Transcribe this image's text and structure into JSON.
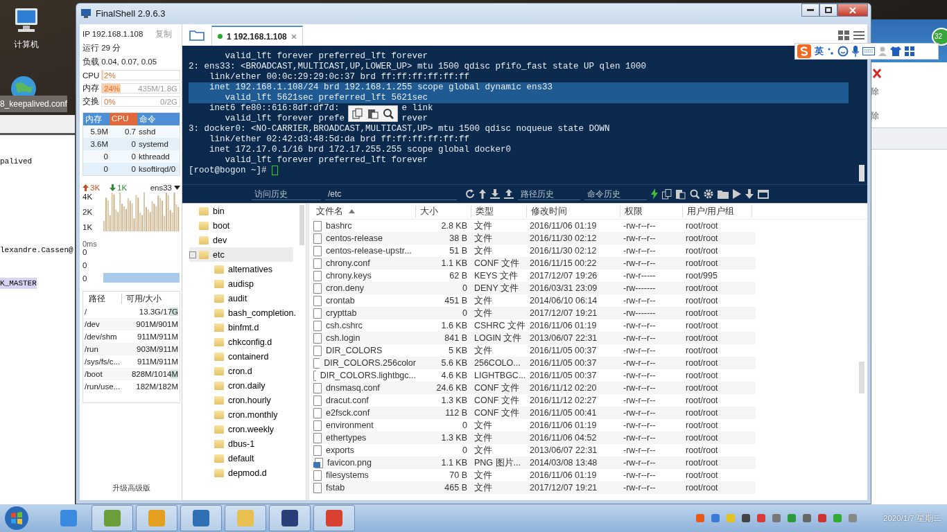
{
  "desktop": {
    "icons": [
      {
        "label": "计算机"
      }
    ]
  },
  "background_editor": {
    "tab": "8_keepalived.conf",
    "lines": [
      {
        "text": "palived",
        "highlighted": false
      },
      {
        "text": "lexandre.Cassen@",
        "highlighted": false
      },
      {
        "text": "K_MASTER",
        "highlighted": true
      }
    ]
  },
  "background_window": {
    "labels": [
      "除",
      "除"
    ],
    "badge": "32"
  },
  "input_method_bar": {
    "mode": "英"
  },
  "window": {
    "title": "FinalShell 2.9.6.3"
  },
  "sidebar": {
    "ip": "IP 192.168.1.108",
    "copy": "复制",
    "uptime": "运行 29 分",
    "load": "负载 0.04, 0.07, 0.05",
    "meters": [
      {
        "label": "CPU",
        "value": "2%",
        "level": 0.02
      },
      {
        "label": "内存",
        "value": "24%",
        "detail": "435M/1.8G",
        "level": 0.24
      },
      {
        "label": "交换",
        "value": "0%",
        "detail": "0/2G"
      }
    ],
    "processes": {
      "columns": [
        {
          "label": "内存",
          "selected": false
        },
        {
          "label": "CPU",
          "selected": true
        },
        {
          "label": "命令",
          "selected": false
        }
      ],
      "rows": [
        [
          "5.9M",
          "0.7",
          "sshd"
        ],
        [
          "3.6M",
          "0",
          "systemd"
        ],
        [
          "0",
          "0",
          "kthreadd"
        ],
        [
          "0",
          "0",
          "ksoftirqd/0"
        ]
      ]
    },
    "network": {
      "upload": "3K",
      "download": "1K",
      "interface": "ens33",
      "axis_labels": [
        "4K",
        "2K",
        "1K"
      ]
    },
    "latency": {
      "title": "0ms",
      "axis_labels": [
        "0",
        "0",
        "0"
      ]
    },
    "disks": {
      "columns": [
        "路径",
        "可用/大小"
      ],
      "rows": [
        {
          "path": "/",
          "usage": "13.3G/17G",
          "level": 0.22
        },
        {
          "path": "/dev",
          "usage": "901M/901M"
        },
        {
          "path": "/dev/shm",
          "usage": "911M/911M"
        },
        {
          "path": "/run",
          "usage": "903M/911M"
        },
        {
          "path": "/sys/fs/c...",
          "usage": "911M/911M"
        },
        {
          "path": "/boot",
          "usage": "828M/1014M",
          "level": 0.18
        },
        {
          "path": "/run/use...",
          "usage": "182M/182M"
        }
      ]
    },
    "upgrade": "升级高级版"
  },
  "tabs": [
    {
      "label": "1 192.168.1.108",
      "selected": true
    }
  ],
  "terminal": {
    "lines": [
      {
        "text": "       valid_lft forever preferred_lft forever",
        "selected": false
      },
      {
        "text": "2: ens33: <BROADCAST,MULTICAST,UP,LOWER_UP> mtu 1500 qdisc pfifo_fast state UP qlen 1000",
        "selected": false
      },
      {
        "text": "    link/ether 00:0c:29:29:0c:37 brd ff:ff:ff:ff:ff:ff",
        "selected": false
      },
      {
        "text": "    inet 192.168.1.108/24 brd 192.168.1.255 scope global dynamic ens33",
        "selected": true
      },
      {
        "text": "       valid_lft 5621sec preferred_lft 5621sec",
        "selected": true
      },
      {
        "text": "    inet6 fe80::616:8df:df7d:",
        "after": "e link",
        "selected": false
      },
      {
        "text": "       valid_lft forever prefe",
        "after": "rever",
        "selected": false
      },
      {
        "text": "3: docker0: <NO-CARRIER,BROADCAST,MULTICAST,UP> mtu 1500 qdisc noqueue state DOWN",
        "selected": false
      },
      {
        "text": "    link/ether 02:42:d3:48:5d:da brd ff:ff:ff:ff:ff:ff",
        "selected": false
      },
      {
        "text": "    inet 172.17.0.1/16 brd 172.17.255.255 scope global docker0",
        "selected": false
      },
      {
        "text": "       valid_lft forever preferred_lft forever",
        "selected": false
      }
    ],
    "prompt": "[root@bogon ~]# "
  },
  "toolbar": {
    "history": {
      "placeholder": "访问历史"
    },
    "path": {
      "value": "/etc"
    },
    "path_history": {
      "placeholder": "路径历史"
    },
    "command_history": {
      "placeholder": "命令历史"
    }
  },
  "tree": [
    {
      "label": "bin",
      "selected": false,
      "expanded": false
    },
    {
      "label": "boot",
      "selected": false,
      "expanded": false
    },
    {
      "label": "dev",
      "selected": false,
      "expanded": false
    },
    {
      "label": "etc",
      "selected": true,
      "expanded": true,
      "children": [
        {
          "label": "alternatives"
        },
        {
          "label": "audisp"
        },
        {
          "label": "audit"
        },
        {
          "label": "bash_completion."
        },
        {
          "label": "binfmt.d"
        },
        {
          "label": "chkconfig.d"
        },
        {
          "label": "containerd"
        },
        {
          "label": "cron.d"
        },
        {
          "label": "cron.daily"
        },
        {
          "label": "cron.hourly"
        },
        {
          "label": "cron.monthly"
        },
        {
          "label": "cron.weekly"
        },
        {
          "label": "dbus-1"
        },
        {
          "label": "default"
        },
        {
          "label": "depmod.d"
        }
      ]
    }
  ],
  "files": {
    "columns": [
      {
        "label": "文件名",
        "sorted": true
      },
      {
        "label": "大小",
        "sorted": false
      },
      {
        "label": "类型",
        "sorted": false
      },
      {
        "label": "修改时间",
        "sorted": false
      },
      {
        "label": "权限",
        "sorted": false
      },
      {
        "label": "用户/用户组",
        "sorted": false
      }
    ],
    "rows": [
      {
        "kind": "file",
        "cells": [
          "bashrc",
          "2.8 KB",
          "文件",
          "2016/11/06 01:19",
          "-rw-r--r--",
          "root/root"
        ]
      },
      {
        "kind": "file",
        "cells": [
          "centos-release",
          "38 B",
          "文件",
          "2016/11/30 02:12",
          "-rw-r--r--",
          "root/root"
        ]
      },
      {
        "kind": "file",
        "cells": [
          "centos-release-upstr...",
          "51 B",
          "文件",
          "2016/11/30 02:12",
          "-rw-r--r--",
          "root/root"
        ]
      },
      {
        "kind": "file",
        "cells": [
          "chrony.conf",
          "1.1 KB",
          "CONF 文件",
          "2016/11/15 00:22",
          "-rw-r--r--",
          "root/root"
        ]
      },
      {
        "kind": "file",
        "cells": [
          "chrony.keys",
          "62 B",
          "KEYS 文件",
          "2017/12/07 19:26",
          "-rw-r-----",
          "root/995"
        ]
      },
      {
        "kind": "file",
        "cells": [
          "cron.deny",
          "0",
          "DENY 文件",
          "2016/03/31 23:09",
          "-rw-------",
          "root/root"
        ]
      },
      {
        "kind": "file",
        "cells": [
          "crontab",
          "451 B",
          "文件",
          "2014/06/10 06:14",
          "-rw-r--r--",
          "root/root"
        ]
      },
      {
        "kind": "file",
        "cells": [
          "crypttab",
          "0",
          "文件",
          "2017/12/07 19:21",
          "-rw-------",
          "root/root"
        ]
      },
      {
        "kind": "file",
        "cells": [
          "csh.cshrc",
          "1.6 KB",
          "CSHRC 文件",
          "2016/11/06 01:19",
          "-rw-r--r--",
          "root/root"
        ]
      },
      {
        "kind": "file",
        "cells": [
          "csh.login",
          "841 B",
          "LOGIN 文件",
          "2013/06/07 22:31",
          "-rw-r--r--",
          "root/root"
        ]
      },
      {
        "kind": "file",
        "cells": [
          "DIR_COLORS",
          "5 KB",
          "文件",
          "2016/11/05 00:37",
          "-rw-r--r--",
          "root/root"
        ]
      },
      {
        "kind": "file",
        "cells": [
          "DIR_COLORS.256color",
          "5.6 KB",
          "256COLO...",
          "2016/11/05 00:37",
          "-rw-r--r--",
          "root/root"
        ]
      },
      {
        "kind": "file",
        "cells": [
          "DIR_COLORS.lightbgc...",
          "4.6 KB",
          "LIGHTBGC...",
          "2016/11/05 00:37",
          "-rw-r--r--",
          "root/root"
        ]
      },
      {
        "kind": "file",
        "cells": [
          "dnsmasq.conf",
          "24.6 KB",
          "CONF 文件",
          "2016/11/12 02:20",
          "-rw-r--r--",
          "root/root"
        ]
      },
      {
        "kind": "file",
        "cells": [
          "dracut.conf",
          "1.3 KB",
          "CONF 文件",
          "2016/11/12 02:27",
          "-rw-r--r--",
          "root/root"
        ]
      },
      {
        "kind": "file",
        "cells": [
          "e2fsck.conf",
          "112 B",
          "CONF 文件",
          "2016/11/05 00:41",
          "-rw-r--r--",
          "root/root"
        ]
      },
      {
        "kind": "file",
        "cells": [
          "environment",
          "0",
          "文件",
          "2016/11/06 01:19",
          "-rw-r--r--",
          "root/root"
        ]
      },
      {
        "kind": "file",
        "cells": [
          "ethertypes",
          "1.3 KB",
          "文件",
          "2016/11/06 04:52",
          "-rw-r--r--",
          "root/root"
        ]
      },
      {
        "kind": "file",
        "cells": [
          "exports",
          "0",
          "文件",
          "2013/06/07 22:31",
          "-rw-r--r--",
          "root/root"
        ]
      },
      {
        "kind": "image",
        "cells": [
          "favicon.png",
          "1.1 KB",
          "PNG 图片...",
          "2014/03/08 13:48",
          "-rw-r--r--",
          "root/root"
        ]
      },
      {
        "kind": "file",
        "cells": [
          "filesystems",
          "70 B",
          "文件",
          "2016/11/06 01:19",
          "-rw-r--r--",
          "root/root"
        ]
      },
      {
        "kind": "file",
        "cells": [
          "fstab",
          "465 B",
          "文件",
          "2017/12/07 19:21",
          "-rw-r--r--",
          "root/root"
        ]
      }
    ]
  },
  "taskbar": {
    "apps": [
      {
        "kind": "pinned"
      },
      {
        "kind": "running"
      },
      {
        "kind": "running"
      },
      {
        "kind": "running"
      },
      {
        "kind": "running"
      },
      {
        "kind": "running"
      },
      {
        "kind": "running"
      }
    ],
    "date": "2020/1/7 星期二"
  }
}
